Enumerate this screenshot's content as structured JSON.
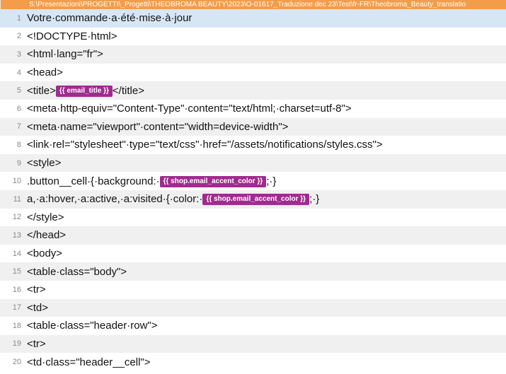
{
  "path_bar": "S:\\Presentazioni\\PROGETTI\\_Progetti\\THEOBROMA BEAUTY\\2023\\O-01617_Traduzione dec 23\\Test\\fr-FR\\Theobroma_Beauty_translatio",
  "lines": [
    {
      "n": "1",
      "alt": false,
      "sel": true,
      "parts": [
        {
          "t": "text",
          "v": "Votre·commande·a·été·mise·à·jour"
        }
      ]
    },
    {
      "n": "2",
      "alt": false,
      "sel": false,
      "parts": [
        {
          "t": "text",
          "v": "<!DOCTYPE·html>"
        }
      ]
    },
    {
      "n": "3",
      "alt": true,
      "sel": false,
      "parts": [
        {
          "t": "text",
          "v": "<html·lang=\"fr\">"
        }
      ]
    },
    {
      "n": "4",
      "alt": false,
      "sel": false,
      "parts": [
        {
          "t": "text",
          "v": "<head>"
        }
      ]
    },
    {
      "n": "5",
      "alt": true,
      "sel": false,
      "parts": [
        {
          "t": "text",
          "v": "<title>"
        },
        {
          "t": "pill",
          "v": "{{ email_title }}"
        },
        {
          "t": "text",
          "v": "</title>"
        }
      ]
    },
    {
      "n": "6",
      "alt": false,
      "sel": false,
      "parts": [
        {
          "t": "text",
          "v": "<meta·http-equiv=\"Content-Type\"·content=\"text/html;·charset=utf-8\">"
        }
      ]
    },
    {
      "n": "7",
      "alt": true,
      "sel": false,
      "parts": [
        {
          "t": "text",
          "v": "<meta·name=\"viewport\"·content=\"width=device-width\">"
        }
      ]
    },
    {
      "n": "8",
      "alt": false,
      "sel": false,
      "parts": [
        {
          "t": "text",
          "v": "<link·rel=\"stylesheet\"·type=\"text/css\"·href=\"/assets/notifications/styles.css\">"
        }
      ]
    },
    {
      "n": "9",
      "alt": true,
      "sel": false,
      "parts": [
        {
          "t": "text",
          "v": "<style>"
        }
      ]
    },
    {
      "n": "10",
      "alt": false,
      "sel": false,
      "parts": [
        {
          "t": "text",
          "v": ".button__cell·{·background:·"
        },
        {
          "t": "pill",
          "v": "{{ shop.email_accent_color }}"
        },
        {
          "t": "text",
          "v": ";·}"
        }
      ]
    },
    {
      "n": "11",
      "alt": true,
      "sel": false,
      "parts": [
        {
          "t": "text",
          "v": "a,·a:hover,·a:active,·a:visited·{·color:·"
        },
        {
          "t": "pill",
          "v": "{{ shop.email_accent_color }}"
        },
        {
          "t": "text",
          "v": ";·}"
        }
      ]
    },
    {
      "n": "12",
      "alt": false,
      "sel": false,
      "parts": [
        {
          "t": "text",
          "v": "</style>"
        }
      ]
    },
    {
      "n": "13",
      "alt": true,
      "sel": false,
      "parts": [
        {
          "t": "text",
          "v": "</head>"
        }
      ]
    },
    {
      "n": "14",
      "alt": false,
      "sel": false,
      "parts": [
        {
          "t": "text",
          "v": "<body>"
        }
      ]
    },
    {
      "n": "15",
      "alt": true,
      "sel": false,
      "parts": [
        {
          "t": "text",
          "v": "<table·class=\"body\">"
        }
      ]
    },
    {
      "n": "16",
      "alt": false,
      "sel": false,
      "parts": [
        {
          "t": "text",
          "v": "<tr>"
        }
      ]
    },
    {
      "n": "17",
      "alt": true,
      "sel": false,
      "parts": [
        {
          "t": "text",
          "v": "<td>"
        }
      ]
    },
    {
      "n": "18",
      "alt": false,
      "sel": false,
      "parts": [
        {
          "t": "text",
          "v": "<table·class=\"header·row\">"
        }
      ]
    },
    {
      "n": "19",
      "alt": true,
      "sel": false,
      "parts": [
        {
          "t": "text",
          "v": "<tr>"
        }
      ]
    },
    {
      "n": "20",
      "alt": false,
      "sel": false,
      "parts": [
        {
          "t": "text",
          "v": "<td·class=\"header__cell\">"
        }
      ]
    }
  ]
}
